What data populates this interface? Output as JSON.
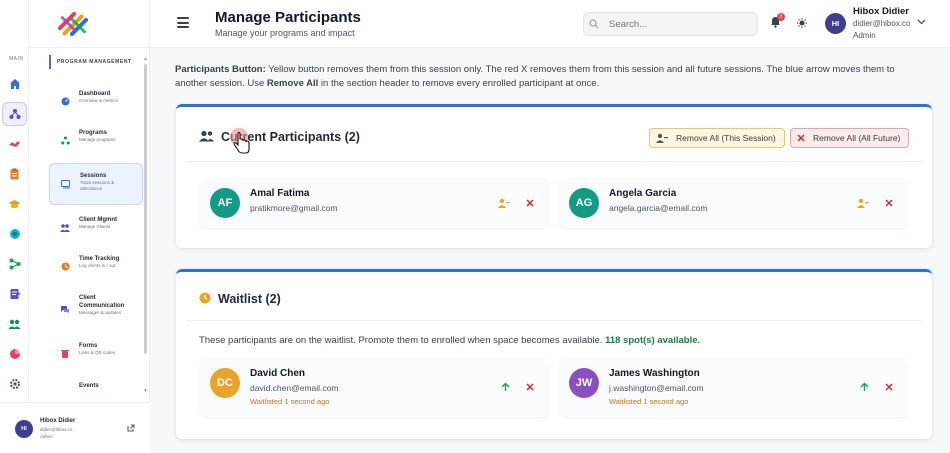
{
  "sidebar": {
    "rail_label": "MAIN",
    "section_title": "PROGRAM MANAGEMENT",
    "items": [
      {
        "title": "Dashboard",
        "subtitle": "Overview & metrics"
      },
      {
        "title": "Programs",
        "subtitle": "Manage programs"
      },
      {
        "title": "Sessions",
        "subtitle": "Track sessions & attendance"
      },
      {
        "title": "Client Mgmnt",
        "subtitle": "Manage Clients"
      },
      {
        "title": "Time Tracking",
        "subtitle": "Log clients in / out"
      },
      {
        "title": "Client Communication",
        "subtitle": "Messages & updates"
      },
      {
        "title": "Forms",
        "subtitle": "Links & QR codes"
      },
      {
        "title": "Events",
        "subtitle": ""
      }
    ],
    "user": {
      "initials": "HI",
      "name": "Hibox Didier",
      "email": "didier@hibox.co",
      "role": "Admin"
    }
  },
  "header": {
    "title": "Manage Participants",
    "subtitle": "Manage your programs and impact",
    "search_placeholder": "Search...",
    "notification_count": "3",
    "user": {
      "initials": "HI",
      "name": "Hibox Didier",
      "email": "didier@hibox.co",
      "role": "Admin"
    }
  },
  "note": {
    "label": "Participants Button:",
    "text1": " Yellow button removes them from this session only. The red X removes them from this session and all future sessions. The blue arrow moves them to another session. Use ",
    "bold": "Remove All",
    "text2": " in the section header to remove every enrolled participant at once."
  },
  "current": {
    "title": "Current Participants (2)",
    "remove_session_label": "Remove All (This Session)",
    "remove_future_label": "Remove All (All Future)",
    "participants": [
      {
        "initials": "AF",
        "name": "Amal Fatima",
        "email": "pratikmore@gmail.com",
        "color": "#159a86"
      },
      {
        "initials": "AG",
        "name": "Angela Garcia",
        "email": "angela.garcia@email.com",
        "color": "#159a86"
      }
    ]
  },
  "waitlist": {
    "title": "Waitlist (2)",
    "description": "These participants are on the waitlist. Promote them to enrolled when space becomes available. ",
    "availability": "118 spot(s) available.",
    "entries": [
      {
        "initials": "DC",
        "name": "David Chen",
        "email": "david.chen@email.com",
        "status": "Waitlisted 1 second ago",
        "color": "#e8a42a"
      },
      {
        "initials": "JW",
        "name": "James Washington",
        "email": "j.washington@email.com",
        "status": "Waitlisted 1 second ago",
        "color": "#8b4fc4"
      }
    ]
  },
  "colors": {
    "accent": "#2f6fd6",
    "brand": "#6d5bd0",
    "danger": "#dc2626",
    "warning": "#e8a42a",
    "success": "#16a34a"
  }
}
